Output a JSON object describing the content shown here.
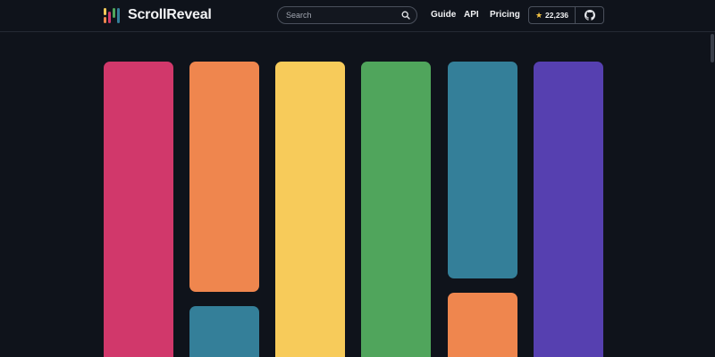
{
  "header": {
    "brand": "ScrollReveal",
    "search_placeholder": "Search",
    "nav": {
      "guide": "Guide",
      "api": "API",
      "pricing": "Pricing"
    },
    "stars": "22,236"
  },
  "colors": {
    "background": "#0f131b",
    "pink": "#d1386b",
    "orange": "#ef864e",
    "yellow": "#f7cb5a",
    "green": "#50a55c",
    "teal": "#347f99",
    "purple": "#5640b0"
  },
  "icons": {
    "search": "search-icon",
    "star": "star-icon",
    "github": "github-icon"
  }
}
